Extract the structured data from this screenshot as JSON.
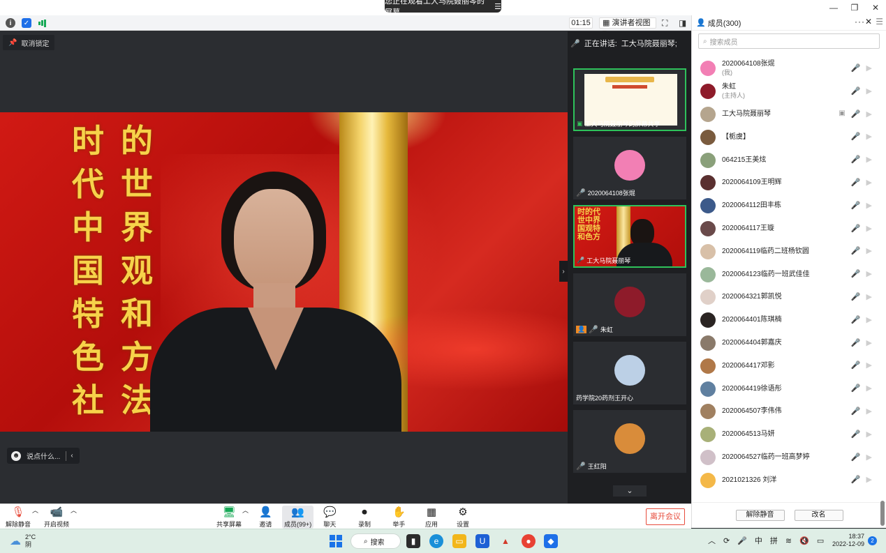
{
  "window": {
    "share_banner": "您正在观看工大马院聂丽琴的屏幕",
    "share_banner_icon": "menu-icon",
    "controls": [
      "—",
      "❐",
      "✕"
    ]
  },
  "topbar": {
    "timer": "01:15",
    "view_mode": "演讲者视图",
    "dropdown_glyph": "▾"
  },
  "stage": {
    "unpin_label": "取消锁定",
    "calligraphy_col1": [
      "时",
      "代",
      "中",
      "国",
      "特",
      "色",
      "社"
    ],
    "calligraphy_col2": [
      "的",
      "世",
      "界",
      "观",
      "和",
      "方",
      "法"
    ],
    "chat_placeholder": "说点什么...",
    "collapse_glyph": "›"
  },
  "gallery": {
    "speaking_prefix": "正在讲话:",
    "speaking_name": "工大马院聂丽琴;",
    "tiles": [
      {
        "label": "工大马院聂丽琴的屏幕共享",
        "kind": "screen",
        "active": true
      },
      {
        "label": "2020064108张焜",
        "kind": "avatar",
        "color": "#f27fb4"
      },
      {
        "label": "工大马院聂丽琴",
        "kind": "video",
        "active": true,
        "mini_text": "时的代世中界国观特和色方"
      },
      {
        "label": "朱虹",
        "kind": "avatar",
        "color": "#8e1b2a"
      },
      {
        "label": "药学院20药剂王开心",
        "kind": "avatar",
        "color": "#bcd0e6"
      },
      {
        "label": "王红阳",
        "kind": "avatar",
        "color": "#d98c3a"
      }
    ],
    "scroll_glyph": "⌄"
  },
  "members": {
    "title": "成员(300)",
    "more_glyph": "···",
    "close_glyph": "✕",
    "search_placeholder": "搜索成员",
    "list": [
      {
        "name": "2020064108张焜",
        "role": "(我)",
        "color": "#f27fb4",
        "mic": "off"
      },
      {
        "name": "朱虹",
        "role": "(主持人)",
        "color": "#8e1b2a",
        "mic": "off"
      },
      {
        "name": "工大马院聂丽琴",
        "role": "",
        "color": "#b5a58e",
        "mic": "on",
        "sharing": true
      },
      {
        "name": "【栀虞】",
        "role": "",
        "color": "#7a5b3e",
        "mic": "off"
      },
      {
        "name": "064215王美炫",
        "role": "",
        "color": "#8aa07a",
        "mic": "off"
      },
      {
        "name": "2020064109王明辉",
        "role": "",
        "color": "#5a3030",
        "mic": "off"
      },
      {
        "name": "2020064112田丰栋",
        "role": "",
        "color": "#3c5a8a",
        "mic": "off"
      },
      {
        "name": "2020064117王璇",
        "role": "",
        "color": "#6a4a4a",
        "mic": "off"
      },
      {
        "name": "2020064119临药二班杨钦圆",
        "role": "",
        "color": "#d8c0a8",
        "mic": "off"
      },
      {
        "name": "2020064123临药一班武佳佳",
        "role": "",
        "color": "#9ab89a",
        "mic": "off"
      },
      {
        "name": "2020064321郭凯悦",
        "role": "",
        "color": "#e0d0c8",
        "mic": "off"
      },
      {
        "name": "2020064401陈琪楠",
        "role": "",
        "color": "#2a2422",
        "mic": "off"
      },
      {
        "name": "2020064404郭嘉庆",
        "role": "",
        "color": "#8a7a6a",
        "mic": "off"
      },
      {
        "name": "2020064417邓影",
        "role": "",
        "color": "#b07848",
        "mic": "off"
      },
      {
        "name": "2020064419徐语彤",
        "role": "",
        "color": "#6080a0",
        "mic": "off"
      },
      {
        "name": "2020064507李伟伟",
        "role": "",
        "color": "#a08060",
        "mic": "off"
      },
      {
        "name": "2020064513马妍",
        "role": "",
        "color": "#a8b078",
        "mic": "off"
      },
      {
        "name": "2020064527临药一班高梦婷",
        "role": "",
        "color": "#d0c0c8",
        "mic": "off"
      },
      {
        "name": "2021021326 刘洋",
        "role": "",
        "color": "#f4b848",
        "mic": "off"
      }
    ],
    "btn_unmute": "解除静音",
    "btn_rename": "改名"
  },
  "bottombar": {
    "unmute": "解除静音",
    "start_video": "开启视频",
    "share_screen": "共享屏幕",
    "invite": "邀请",
    "members": "成员(99+)",
    "chat": "聊天",
    "record": "录制",
    "raise_hand": "举手",
    "apps": "应用",
    "settings": "设置",
    "leave": "离开会议"
  },
  "taskbar": {
    "temperature": "2°C",
    "weather": "阴",
    "search": "搜索",
    "tray": [
      "︿",
      "中",
      "拼"
    ],
    "time": "18:37",
    "date": "2022-12-09",
    "notifications": "2"
  }
}
